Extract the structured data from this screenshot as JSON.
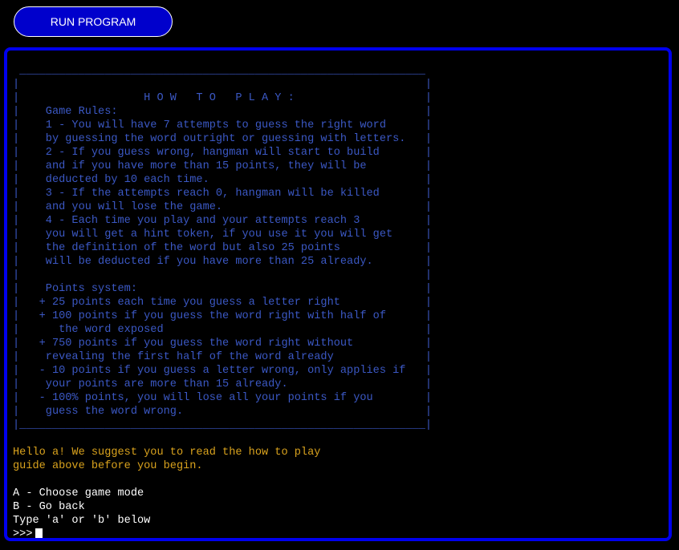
{
  "run_button": {
    "label": "RUN PROGRAM"
  },
  "terminal": {
    "rules_box": [
      " ______________________________________________________________",
      "|                                                              |",
      "|                   H O W   T O   P L A Y :                    |",
      "|    Game Rules:                                               |",
      "|    1 - You will have 7 attempts to guess the right word      |",
      "|    by guessing the word outright or guessing with letters.   |",
      "|    2 - If you guess wrong, hangman will start to build       |",
      "|    and if you have more than 15 points, they will be         |",
      "|    deducted by 10 each time.                                 |",
      "|    3 - If the attempts reach 0, hangman will be killed       |",
      "|    and you will lose the game.                               |",
      "|    4 - Each time you play and your attempts reach 3          |",
      "|    you will get a hint token, if you use it you will get     |",
      "|    the definition of the word but also 25 points             |",
      "|    will be deducted if you have more than 25 already.        |",
      "|                                                              |",
      "|    Points system:                                            |",
      "|   + 25 points each time you guess a letter right             |",
      "|   + 100 points if you guess the word right with half of      |",
      "|      the word exposed                                        |",
      "|   + 750 points if you guess the word right without           |",
      "|    revealing the first half of the word already              |",
      "|   - 10 points if you guess a letter wrong, only applies if   |",
      "|    your points are more than 15 already.                     |",
      "|   - 100% points, you will lose all your points if you        |",
      "|    guess the word wrong.                                     |",
      "|______________________________________________________________|"
    ],
    "greeting": [
      "Hello a! We suggest you to read the how to play",
      "guide above before you begin."
    ],
    "menu": [
      "A - Choose game mode",
      "B - Go back",
      "Type 'a' or 'b' below"
    ],
    "prompt": ">>>"
  },
  "colors": {
    "rules_text": "#3b58c4",
    "greeting_text": "#d9a21d",
    "menu_text": "#ffffff",
    "terminal_border": "#0000ee",
    "button_bg": "#0000cc"
  }
}
